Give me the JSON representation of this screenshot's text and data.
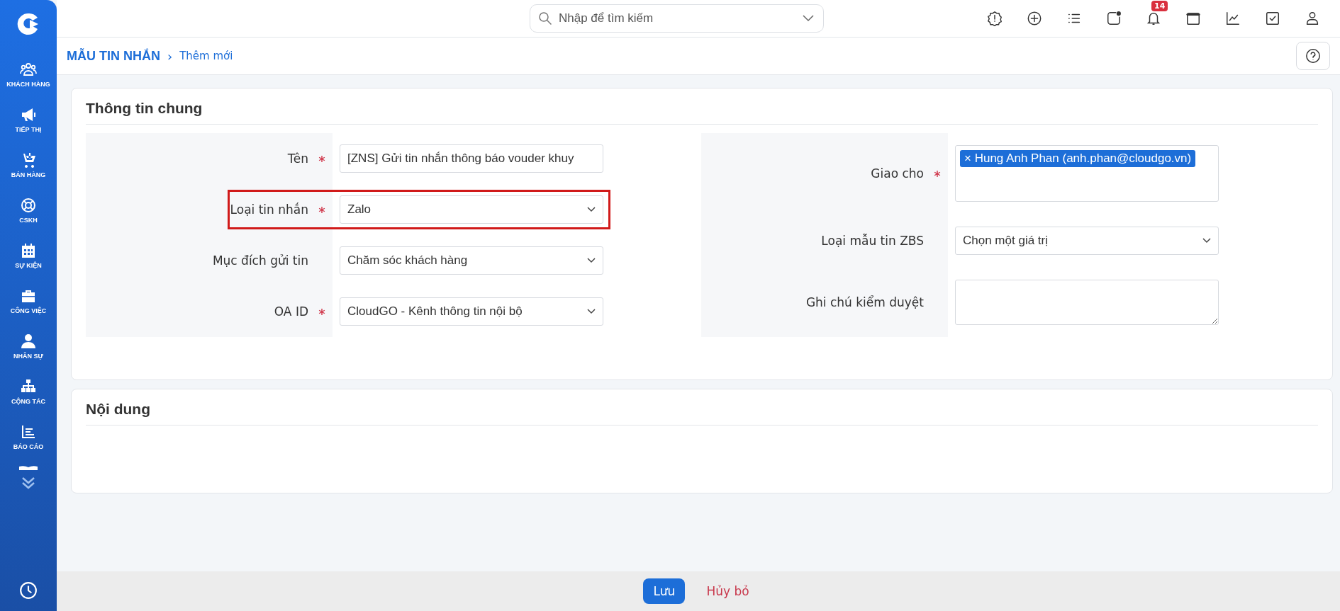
{
  "sidebar": {
    "items": [
      {
        "label": "KHÁCH HÀNG"
      },
      {
        "label": "TIẾP THỊ"
      },
      {
        "label": "BÁN HÀNG"
      },
      {
        "label": "CSKH"
      },
      {
        "label": "SỰ KIỆN"
      },
      {
        "label": "CÔNG VIỆC"
      },
      {
        "label": "NHÂN SỰ"
      },
      {
        "label": "CỘNG TÁC"
      },
      {
        "label": "BÁO CÁO"
      }
    ]
  },
  "search": {
    "placeholder": "Nhập để tìm kiếm"
  },
  "notifications_badge": "14",
  "breadcrumb": {
    "module": "MẪU TIN NHẮN",
    "separator": "›",
    "page": "Thêm mới"
  },
  "sections": [
    {
      "title": "Thông tin chung",
      "left_fields": [
        {
          "label": "Tên",
          "required": true,
          "kind": "text",
          "value": "[ZNS] Gửi tin nhắn thông báo vouder khuy",
          "highlighted": false
        },
        {
          "label": "Loại tin nhắn",
          "required": true,
          "kind": "select",
          "value": "Zalo",
          "highlighted": true
        },
        {
          "label": "Mục đích gửi tin",
          "required": false,
          "kind": "select",
          "value": "Chăm sóc khách hàng",
          "highlighted": false
        },
        {
          "label": "OA ID",
          "required": true,
          "kind": "select",
          "value": "CloudGO - Kênh thông tin nội bộ",
          "highlighted": false
        }
      ],
      "right_fields": [
        {
          "label": "Giao cho",
          "required": true,
          "kind": "tags",
          "tags": [
            {
              "remove": "×",
              "text": "Hung Anh Phan (anh.phan@cloudgo.vn)"
            }
          ],
          "highlighted": false
        },
        {
          "label": "Loại mẫu tin ZBS",
          "required": false,
          "kind": "select",
          "value": "Chọn một giá trị",
          "highlighted": false
        },
        {
          "label": "Ghi chú kiểm duyệt",
          "required": false,
          "kind": "textarea",
          "highlighted": false
        }
      ]
    },
    {
      "title": "Nội dung"
    }
  ],
  "footer": {
    "buttons": [
      {
        "label": "Lưu",
        "kind": "primary"
      },
      {
        "label": "Hủy bỏ",
        "kind": "link"
      }
    ]
  }
}
